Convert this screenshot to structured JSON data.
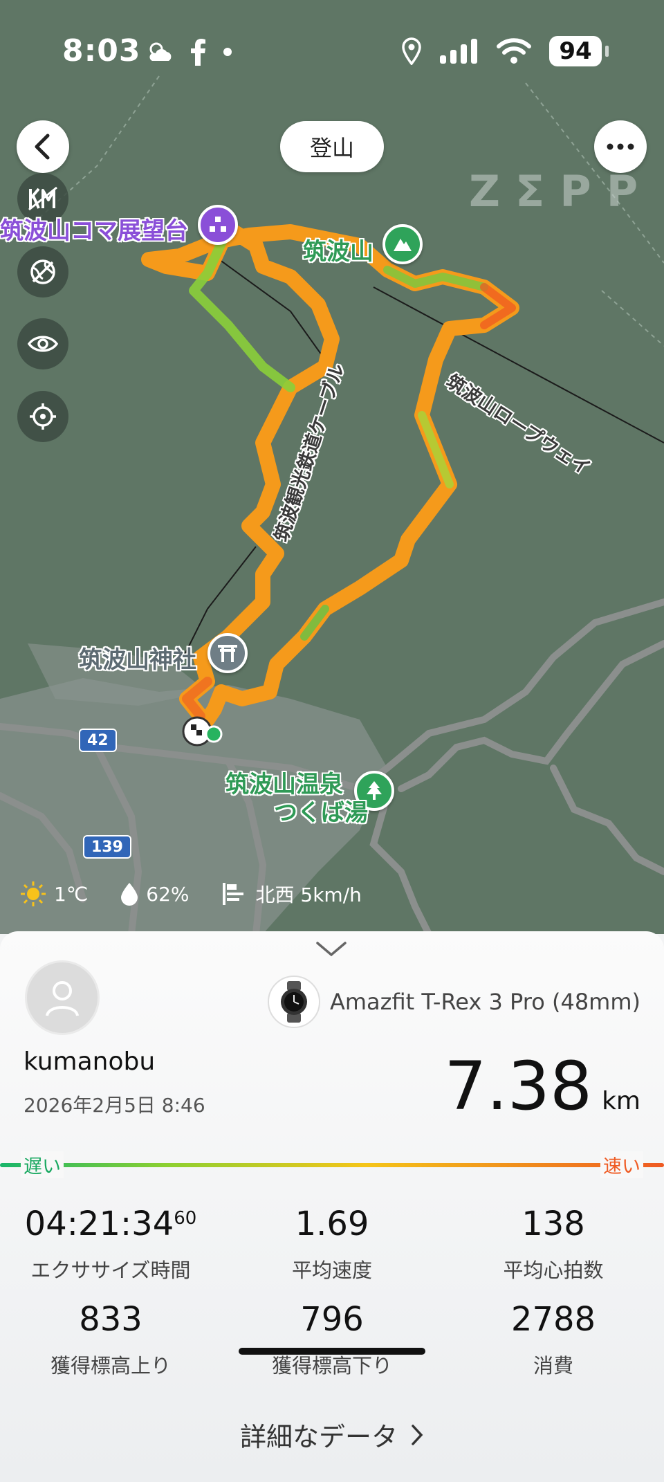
{
  "status_bar": {
    "time": "8:03",
    "battery": "94"
  },
  "header": {
    "title": "登山",
    "watermark": "ZΣPP"
  },
  "map": {
    "labels": {
      "viewpoint": "筑波山コマ展望台",
      "summit": "筑波山",
      "shrine": "筑波山神社",
      "onsen_line1": "筑波山温泉",
      "onsen_line2": "つくば湯",
      "ropeway": "筑波山ロープウェイ",
      "cable": "筑波観光鉄道ケーブル"
    },
    "route_shields": [
      "42",
      "139"
    ],
    "weather": {
      "temp": "1℃",
      "humidity": "62%",
      "wind": "北西 5km/h"
    }
  },
  "summary": {
    "username": "kumanobu",
    "datetime": "2026年2月5日 8:46",
    "device": "Amazfit T-Rex 3 Pro (48mm)",
    "distance_value": "7.38",
    "distance_unit": "km",
    "speed_legend": {
      "slow": "遅い",
      "fast": "速い"
    },
    "stats": [
      {
        "value": "04:21:34",
        "sup": "60",
        "label": "エクササイズ時間"
      },
      {
        "value": "1.69",
        "label": "平均速度"
      },
      {
        "value": "138",
        "label": "平均心拍数"
      },
      {
        "value": "833",
        "label": "獲得標高上り"
      },
      {
        "value": "796",
        "label": "獲得標高下り"
      },
      {
        "value": "2788",
        "label": "消費"
      }
    ],
    "details_link": "詳細なデータ"
  },
  "colors": {
    "slow": "#18b56a",
    "fast": "#ef5a22",
    "summit_pin": "#2fa35a",
    "viewpoint_pin": "#8a4fd8"
  }
}
